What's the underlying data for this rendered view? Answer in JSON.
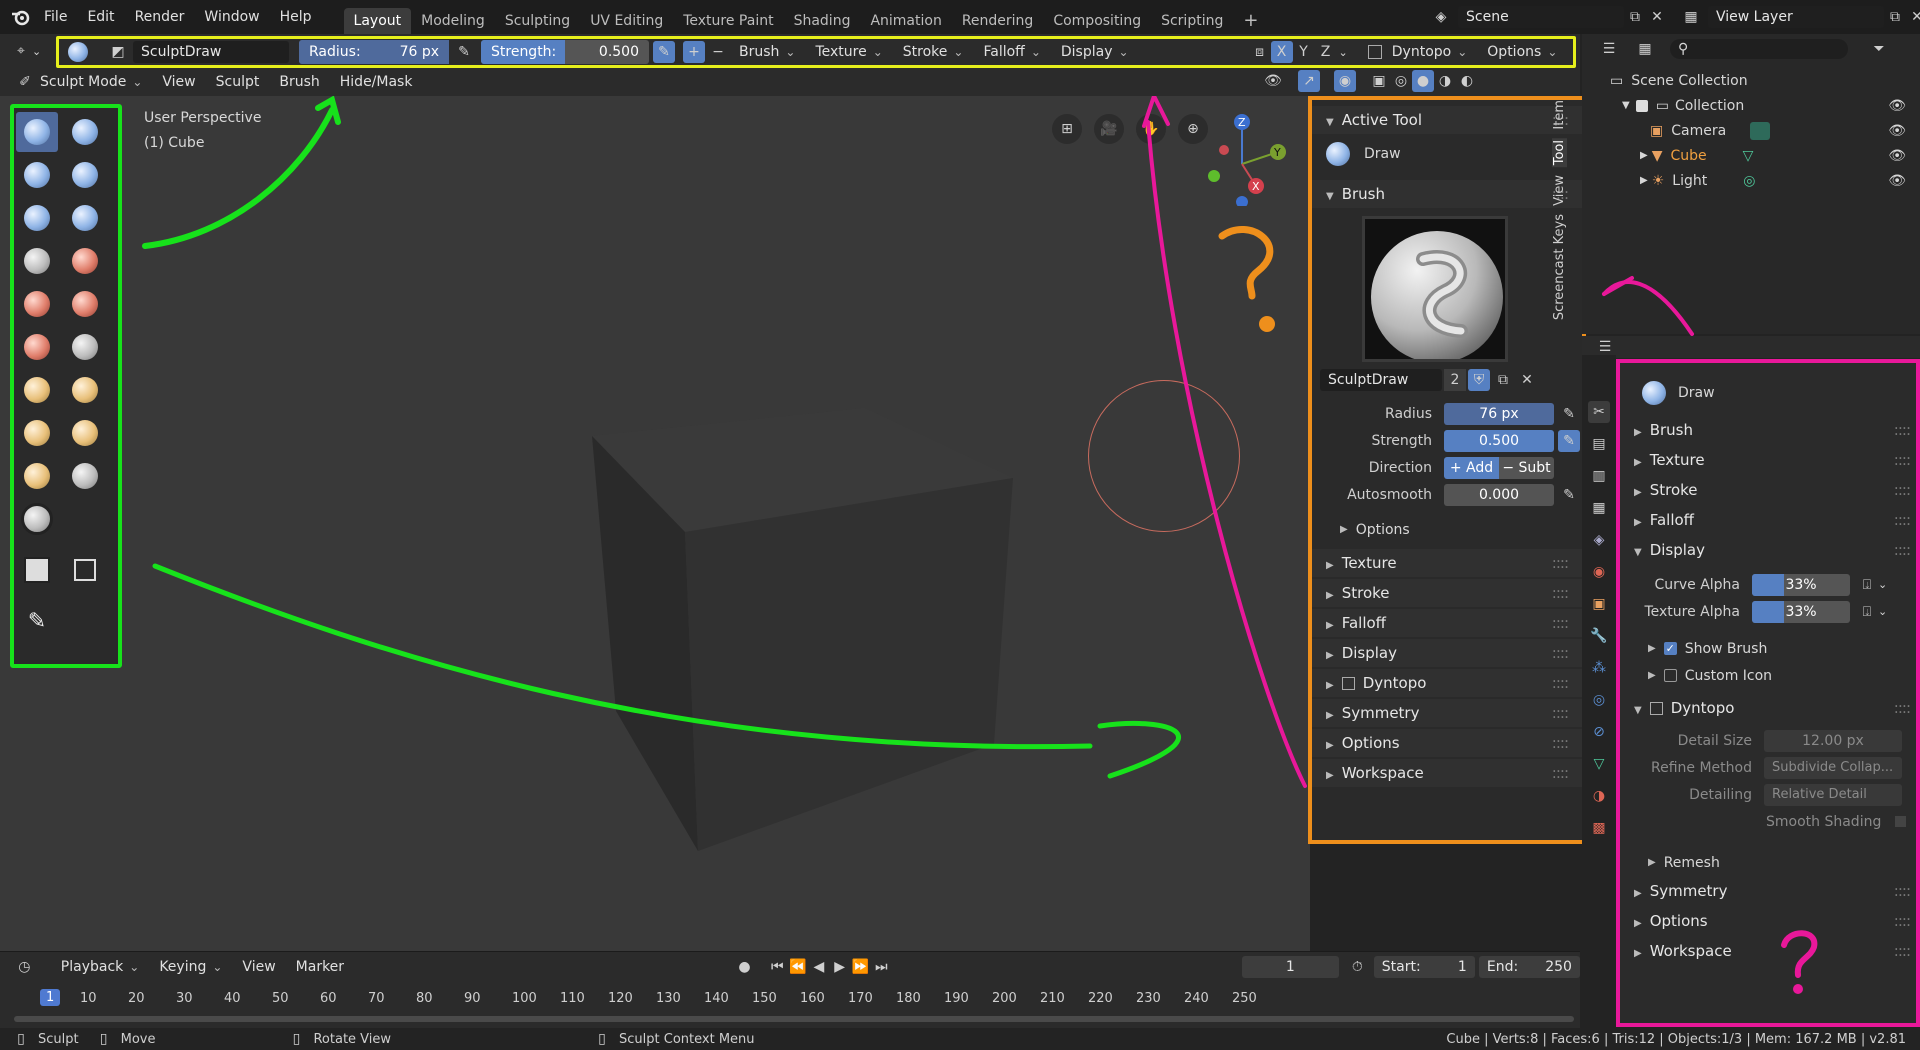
{
  "top_menu": {
    "items": [
      "File",
      "Edit",
      "Render",
      "Window",
      "Help"
    ],
    "workspaces": [
      "Layout",
      "Modeling",
      "Sculpting",
      "UV Editing",
      "Texture Paint",
      "Shading",
      "Animation",
      "Rendering",
      "Compositing",
      "Scripting"
    ],
    "active_workspace": "Layout",
    "add_tab": "+",
    "scene": "Scene",
    "view_layer": "View Layer"
  },
  "tool_header": {
    "brush_name": "SculptDraw",
    "radius_label": "Radius:",
    "radius_value": "76 px",
    "strength_label": "Strength:",
    "strength_value": "0.500",
    "strength_fill": 0.5,
    "add": "+",
    "subtract": "−",
    "menus": [
      "Brush",
      "Texture",
      "Stroke",
      "Falloff",
      "Display"
    ],
    "axes": [
      "X",
      "Y",
      "Z"
    ],
    "dyntopo": "Dyntopo",
    "options": "Options"
  },
  "mode_header": {
    "mode": "Sculpt Mode",
    "menus": [
      "View",
      "Sculpt",
      "Brush",
      "Hide/Mask"
    ]
  },
  "viewport": {
    "perspective": "User Perspective",
    "object": "(1) Cube",
    "gizmo_axes": [
      "Z",
      "Y",
      "X"
    ]
  },
  "npanel": {
    "active_tool_header": "Active Tool",
    "active_tool_name": "Draw",
    "brush_header": "Brush",
    "brush_datablock": "SculptDraw",
    "brush_users": "2",
    "radius_label": "Radius",
    "radius_value": "76 px",
    "strength_label": "Strength",
    "strength_value": "0.500",
    "direction_label": "Direction",
    "direction_add": "+ Add",
    "direction_sub": "− Subt",
    "autosmooth_label": "Autosmooth",
    "autosmooth_value": "0.000",
    "options_sub": "Options",
    "sections": [
      "Texture",
      "Stroke",
      "Falloff",
      "Display",
      "Dyntopo",
      "Symmetry",
      "Options",
      "Workspace"
    ],
    "tabs": [
      "Item",
      "Tool",
      "View",
      "Screencast Keys"
    ]
  },
  "outliner": {
    "root": "Scene Collection",
    "collection": "Collection",
    "items": [
      "Camera",
      "Cube",
      "Light"
    ]
  },
  "properties": {
    "tool_name": "Draw",
    "sections_top": [
      "Brush",
      "Texture",
      "Stroke",
      "Falloff"
    ],
    "display_header": "Display",
    "curve_alpha_label": "Curve Alpha",
    "curve_alpha_value": "33%",
    "texture_alpha_label": "Texture Alpha",
    "texture_alpha_value": "33%",
    "alpha_fill": 0.33,
    "show_brush": "Show Brush",
    "custom_icon": "Custom Icon",
    "dyntopo_header": "Dyntopo",
    "detail_size_label": "Detail Size",
    "detail_size_value": "12.00 px",
    "refine_method_label": "Refine Method",
    "refine_method_value": "Subdivide Collap...",
    "detailing_label": "Detailing",
    "detailing_value": "Relative Detail",
    "smooth_shading": "Smooth Shading",
    "remesh": "Remesh",
    "sections_bottom": [
      "Symmetry",
      "Options",
      "Workspace"
    ]
  },
  "timeline": {
    "menus": [
      "Playback",
      "Keying",
      "View",
      "Marker"
    ],
    "current_frame": "1",
    "start_label": "Start:",
    "start_value": "1",
    "end_label": "End:",
    "end_value": "250",
    "ruler": [
      "1",
      "10",
      "20",
      "30",
      "40",
      "50",
      "60",
      "70",
      "80",
      "90",
      "100",
      "110",
      "120",
      "130",
      "140",
      "150",
      "160",
      "170",
      "180",
      "190",
      "200",
      "210",
      "220",
      "230",
      "240",
      "250"
    ]
  },
  "status": {
    "sculpt": "Sculpt",
    "move": "Move",
    "rotate": "Rotate View",
    "context": "Sculpt Context Menu",
    "stats": "Cube | Verts:8 | Faces:6 | Tris:12 | Objects:1/3 | Mem: 167.2 MB | v2.81"
  },
  "annotation_colors": {
    "toolbar_box": "#17e21b",
    "header_box": "#e6ef1c",
    "npanel_box": "#ee8f1c",
    "properties_box": "#e8189a"
  }
}
